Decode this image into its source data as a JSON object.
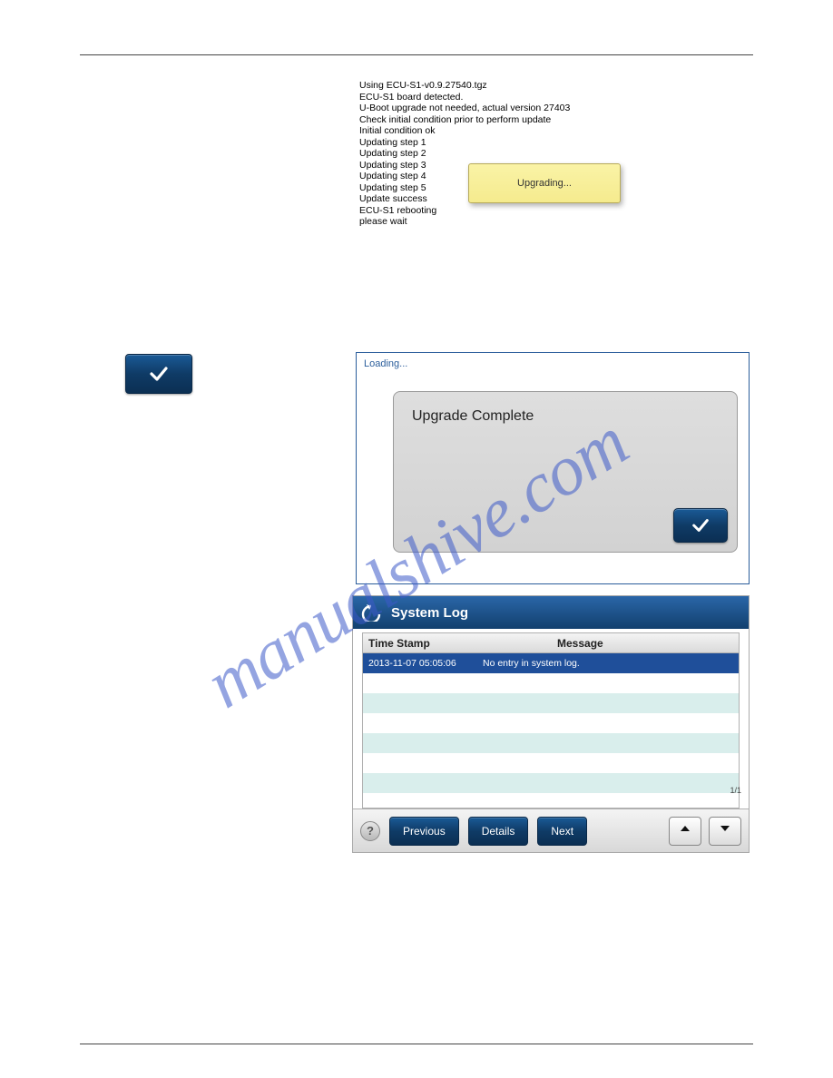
{
  "watermark": "manualshive.com",
  "shot1": {
    "log_lines": [
      "Using ECU-S1-v0.9.27540.tgz",
      "ECU-S1 board detected.",
      "U-Boot upgrade not needed, actual version 27403",
      "Check initial condition prior to perform update",
      "Initial condition ok",
      "Updating step 1",
      "Updating step 2",
      "Updating step 3",
      "Updating step 4",
      "Updating step 5",
      "Update success",
      "ECU-S1 rebooting",
      "please wait"
    ],
    "tooltip": "Upgrading..."
  },
  "shot2": {
    "loading": "Loading...",
    "dialog_title": "Upgrade Complete"
  },
  "shot3": {
    "title": "System Log",
    "columns": {
      "time_stamp": "Time Stamp",
      "message": "Message"
    },
    "rows": [
      {
        "time_stamp": "2013-11-07 05:05:06",
        "message": "No entry in system log."
      }
    ],
    "buttons": {
      "help": "?",
      "previous": "Previous",
      "details": "Details",
      "next": "Next"
    },
    "pager": "1/1"
  }
}
